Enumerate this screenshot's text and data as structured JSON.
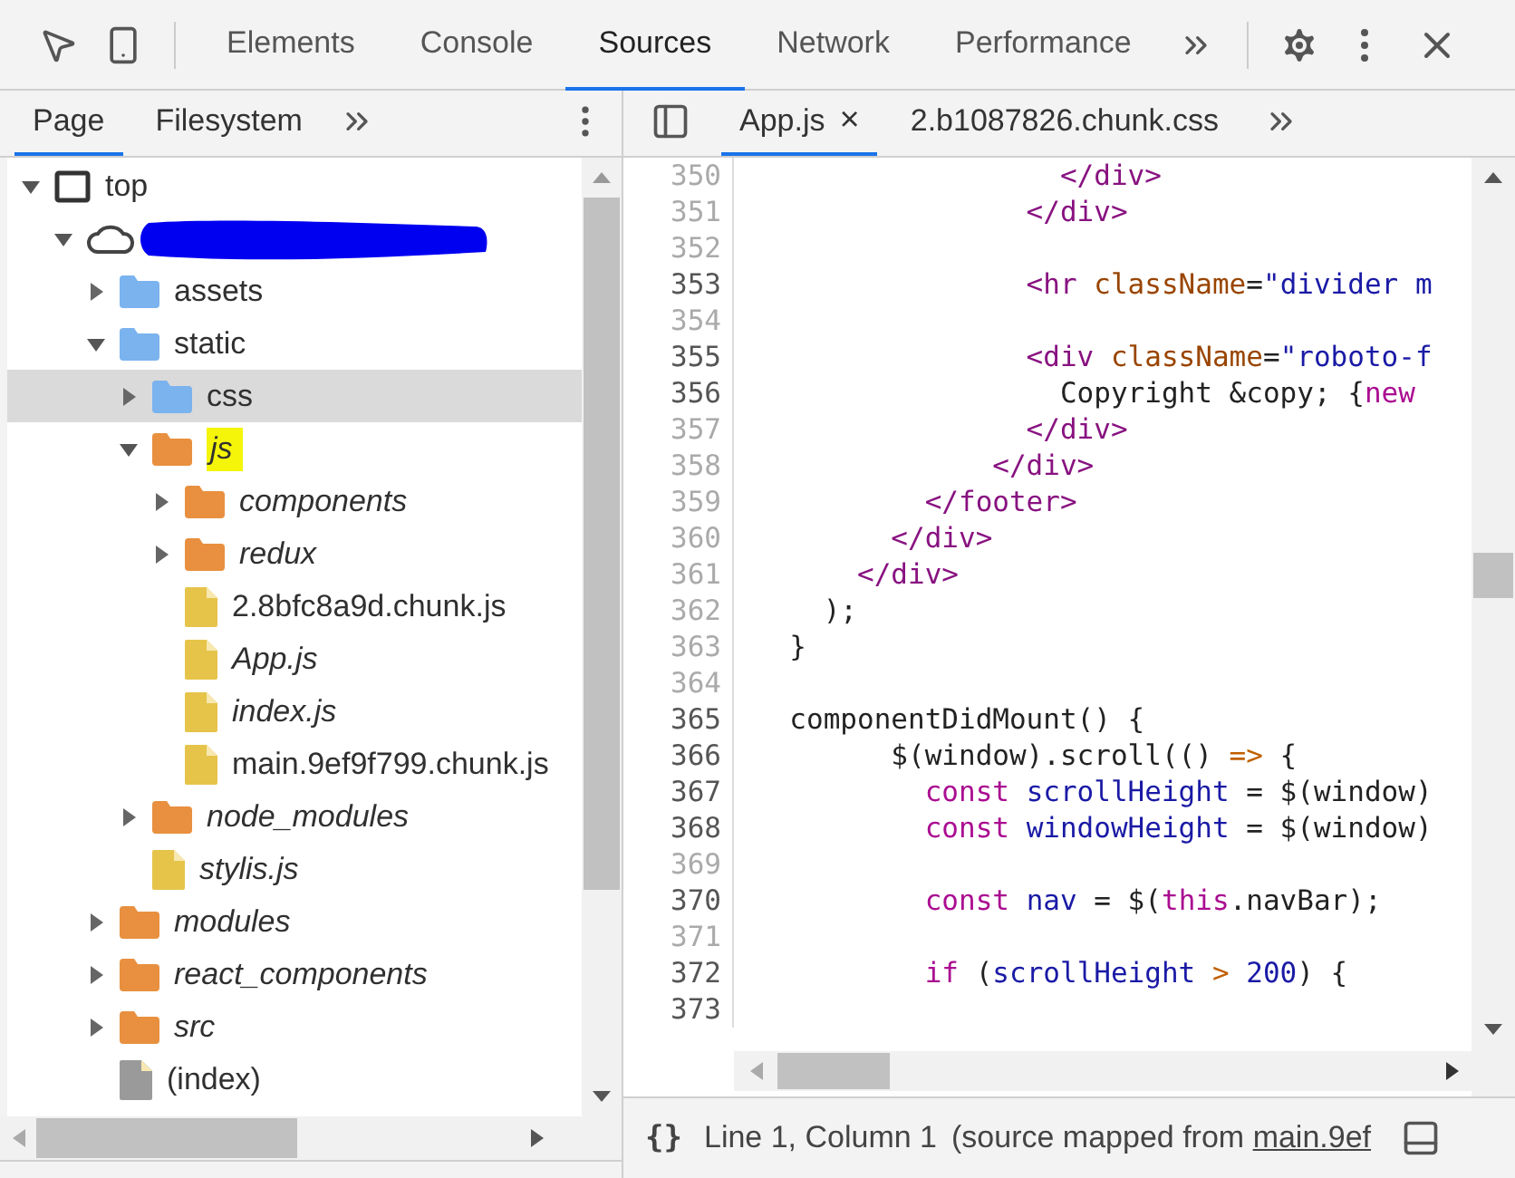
{
  "toolbar": {
    "tabs": [
      {
        "label": "Elements",
        "selected": false
      },
      {
        "label": "Console",
        "selected": false
      },
      {
        "label": "Sources",
        "selected": true
      },
      {
        "label": "Network",
        "selected": false
      },
      {
        "label": "Performance",
        "selected": false
      }
    ]
  },
  "navigator": {
    "tabs": [
      {
        "label": "Page",
        "selected": true
      },
      {
        "label": "Filesystem",
        "selected": false
      }
    ],
    "tree": [
      {
        "kind": "frame",
        "label": "top",
        "expanded": true,
        "children": [
          {
            "kind": "cloud",
            "redacted": true,
            "expanded": true,
            "children": [
              {
                "kind": "folder",
                "label": "assets",
                "color": "#7ab3ee",
                "mapped": false,
                "expanded": false
              },
              {
                "kind": "folder",
                "label": "static",
                "color": "#7ab3ee",
                "mapped": false,
                "expanded": true,
                "children": [
                  {
                    "kind": "folder",
                    "label": "css",
                    "color": "#7ab3ee",
                    "mapped": false,
                    "expanded": false,
                    "selected": true
                  },
                  {
                    "kind": "folder",
                    "label": "js",
                    "color": "#e8903f",
                    "mapped": true,
                    "expanded": true,
                    "highlighted": true,
                    "children": [
                      {
                        "kind": "folder",
                        "label": "components",
                        "color": "#e8903f",
                        "mapped": true,
                        "expanded": false
                      },
                      {
                        "kind": "folder",
                        "label": "redux",
                        "color": "#e8903f",
                        "mapped": true,
                        "expanded": false
                      },
                      {
                        "kind": "file",
                        "label": "2.8bfc8a9d.chunk.js",
                        "color": "#e6c44a",
                        "mapped": false
                      },
                      {
                        "kind": "file",
                        "label": "App.js",
                        "color": "#e6c44a",
                        "mapped": true
                      },
                      {
                        "kind": "file",
                        "label": "index.js",
                        "color": "#e6c44a",
                        "mapped": true
                      },
                      {
                        "kind": "file",
                        "label": "main.9ef9f799.chunk.js",
                        "color": "#e6c44a",
                        "mapped": false
                      }
                    ]
                  },
                  {
                    "kind": "folder",
                    "label": "node_modules",
                    "color": "#e8903f",
                    "mapped": true,
                    "expanded": false
                  },
                  {
                    "kind": "file",
                    "label": "stylis.js",
                    "color": "#e6c44a",
                    "mapped": true
                  }
                ]
              },
              {
                "kind": "folder",
                "label": "modules",
                "color": "#e8903f",
                "mapped": true,
                "expanded": false
              },
              {
                "kind": "folder",
                "label": "react_components",
                "color": "#e8903f",
                "mapped": true,
                "expanded": false
              },
              {
                "kind": "folder",
                "label": "src",
                "color": "#e8903f",
                "mapped": true,
                "expanded": false
              },
              {
                "kind": "file",
                "label": "(index)",
                "color": "#9a9a9a",
                "mapped": false
              }
            ]
          }
        ]
      }
    ]
  },
  "editor": {
    "tabs": [
      {
        "label": "App.js",
        "selected": true,
        "close": "×"
      },
      {
        "label": "2.b1087826.chunk.css",
        "selected": false
      }
    ],
    "lines": [
      {
        "number": "350",
        "mapped": false,
        "tokens": [
          {
            "kind": "tag",
            "text": "                  </div>"
          }
        ]
      },
      {
        "number": "351",
        "mapped": false,
        "tokens": [
          {
            "kind": "tag",
            "text": "                </div>"
          }
        ]
      },
      {
        "number": "352",
        "mapped": false
      },
      {
        "number": "353",
        "mapped": true,
        "tokens": [
          {
            "kind": "tag",
            "text": "                <hr"
          },
          {
            "kind": "attr",
            "text": " className"
          },
          {
            "kind": "plain",
            "text": "="
          },
          {
            "kind": "string",
            "text": "\"divider m"
          }
        ]
      },
      {
        "number": "354",
        "mapped": false
      },
      {
        "number": "355",
        "mapped": true,
        "tokens": [
          {
            "kind": "tag",
            "text": "                <div"
          },
          {
            "kind": "attr",
            "text": " className"
          },
          {
            "kind": "plain",
            "text": "="
          },
          {
            "kind": "string",
            "text": "\"roboto-f"
          }
        ]
      },
      {
        "number": "356",
        "mapped": true,
        "tokens": [
          {
            "kind": "plain",
            "text": "                  Copyright &copy; {"
          },
          {
            "kind": "keyword",
            "text": "new"
          }
        ]
      },
      {
        "number": "357",
        "mapped": false,
        "tokens": [
          {
            "kind": "tag",
            "text": "                </div>"
          }
        ]
      },
      {
        "number": "358",
        "mapped": false,
        "tokens": [
          {
            "kind": "tag",
            "text": "              </div>"
          }
        ]
      },
      {
        "number": "359",
        "mapped": false,
        "tokens": [
          {
            "kind": "tag",
            "text": "          </footer>"
          }
        ]
      },
      {
        "number": "360",
        "mapped": false,
        "tokens": [
          {
            "kind": "tag",
            "text": "        </div>"
          }
        ]
      },
      {
        "number": "361",
        "mapped": false,
        "tokens": [
          {
            "kind": "tag",
            "text": "      </div>"
          }
        ]
      },
      {
        "number": "362",
        "mapped": false,
        "tokens": [
          {
            "kind": "plain",
            "text": "    );"
          }
        ]
      },
      {
        "number": "363",
        "mapped": false,
        "tokens": [
          {
            "kind": "plain",
            "text": "  }"
          }
        ]
      },
      {
        "number": "364",
        "mapped": false
      },
      {
        "number": "365",
        "mapped": true,
        "tokens": [
          {
            "kind": "plain",
            "text": "  componentDidMount() {"
          }
        ]
      },
      {
        "number": "366",
        "mapped": true,
        "tokens": [
          {
            "kind": "plain",
            "text": "        $(window).scroll(() "
          },
          {
            "kind": "operator",
            "text": "=>"
          },
          {
            "kind": "plain",
            "text": " {"
          }
        ]
      },
      {
        "number": "367",
        "mapped": true,
        "tokens": [
          {
            "kind": "keyword",
            "text": "          const"
          },
          {
            "kind": "variable",
            "text": " scrollHeight"
          },
          {
            "kind": "plain",
            "text": " = $(window)"
          }
        ]
      },
      {
        "number": "368",
        "mapped": true,
        "tokens": [
          {
            "kind": "keyword",
            "text": "          const"
          },
          {
            "kind": "variable",
            "text": " windowHeight"
          },
          {
            "kind": "plain",
            "text": " = $(window)"
          }
        ]
      },
      {
        "number": "369",
        "mapped": false
      },
      {
        "number": "370",
        "mapped": true,
        "tokens": [
          {
            "kind": "keyword",
            "text": "          const"
          },
          {
            "kind": "variable",
            "text": " nav"
          },
          {
            "kind": "plain",
            "text": " = $("
          },
          {
            "kind": "keyword",
            "text": "this"
          },
          {
            "kind": "plain",
            "text": ".navBar);"
          }
        ]
      },
      {
        "number": "371",
        "mapped": false
      },
      {
        "number": "372",
        "mapped": true,
        "tokens": [
          {
            "kind": "keyword",
            "text": "          if"
          },
          {
            "kind": "plain",
            "text": " ("
          },
          {
            "kind": "variable",
            "text": "scrollHeight"
          },
          {
            "kind": "operator",
            "text": " >"
          },
          {
            "kind": "variable",
            "text": " 200"
          },
          {
            "kind": "plain",
            "text": ") {"
          }
        ]
      },
      {
        "number": "373",
        "mapped": true
      }
    ]
  },
  "status_bar": {
    "format": "{}",
    "position": "Line 1, Column 1",
    "source_prefix": "(source mapped from ",
    "source_link": "main.9ef"
  }
}
